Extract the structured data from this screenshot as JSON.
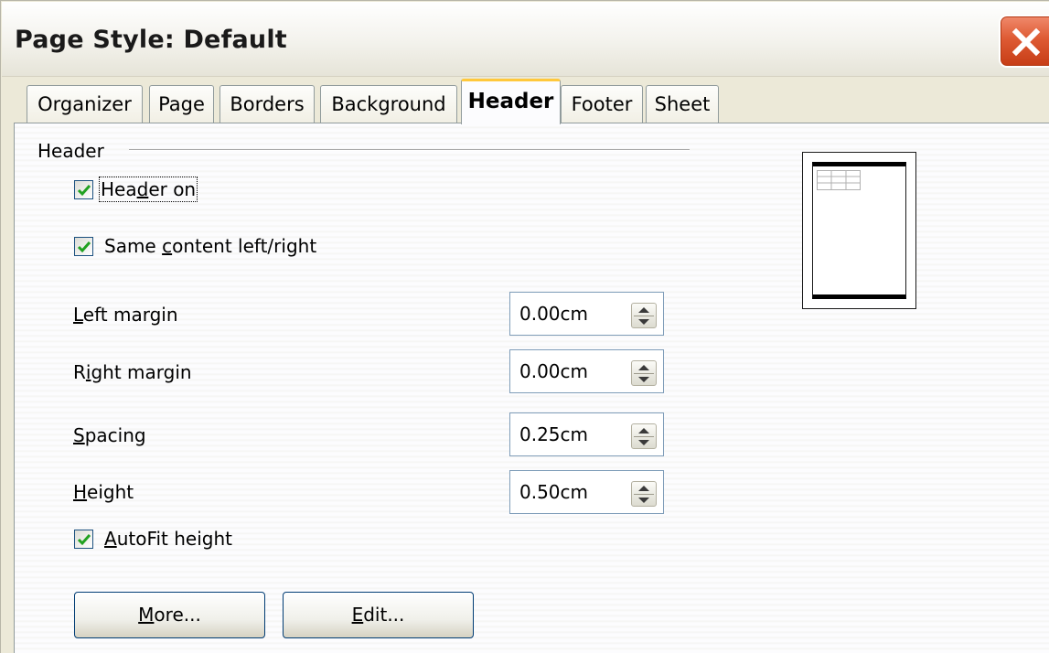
{
  "window": {
    "title": "Page Style: Default"
  },
  "tabs": [
    {
      "label": "Organizer",
      "active": false
    },
    {
      "label": "Page",
      "active": false
    },
    {
      "label": "Borders",
      "active": false
    },
    {
      "label": "Background",
      "active": false
    },
    {
      "label": "Header",
      "active": true
    },
    {
      "label": "Footer",
      "active": false
    },
    {
      "label": "Sheet",
      "active": false
    }
  ],
  "header_section": {
    "label": "Header",
    "header_on": {
      "pre": "Hea",
      "key": "d",
      "post": "er on",
      "checked": true
    },
    "same_content": {
      "pre": "Same ",
      "key": "c",
      "post": "ontent left/right",
      "checked": true
    },
    "autofit": {
      "pre": "",
      "key": "A",
      "post": "utoFit height",
      "checked": true
    }
  },
  "fields": {
    "left_margin": {
      "pre": "",
      "key": "L",
      "post": "eft margin",
      "value": "0.00cm"
    },
    "right_margin": {
      "pre": "R",
      "key": "i",
      "post": "ght margin",
      "value": "0.00cm"
    },
    "spacing": {
      "pre": "",
      "key": "S",
      "post": "pacing",
      "value": "0.25cm"
    },
    "height": {
      "pre": "",
      "key": "H",
      "post": "eight",
      "value": "0.50cm"
    }
  },
  "buttons": {
    "more": {
      "pre": "",
      "key": "M",
      "post": "ore..."
    },
    "edit": {
      "pre": "",
      "key": "E",
      "post": "dit..."
    }
  },
  "icons": {
    "close": "close-icon",
    "check": "checkmark-icon",
    "spin": "spin-arrows-icon"
  },
  "colors": {
    "close_button": "#de5a33",
    "active_tab_accent": "#ffc83c",
    "checkmark": "#21a121",
    "dialog_background": "#ece9d8"
  }
}
